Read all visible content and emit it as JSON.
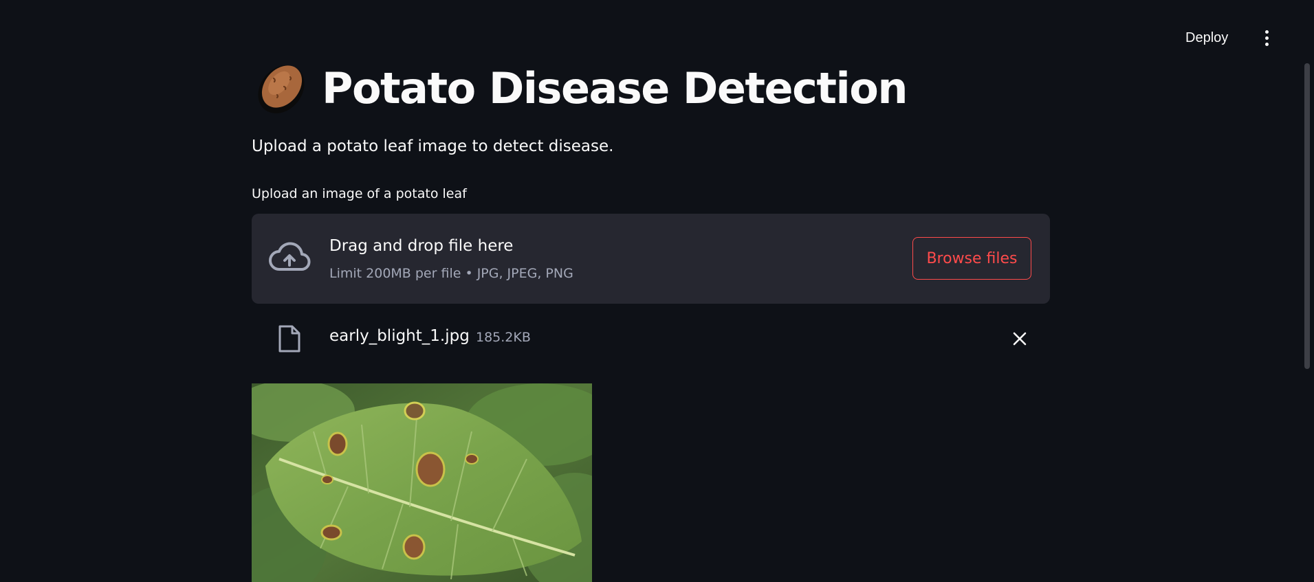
{
  "header": {
    "deploy_label": "Deploy",
    "menu_icon": "vertical-dots-icon"
  },
  "main": {
    "title_icon": "potato-emoji",
    "title": "Potato Disease Detection",
    "subtitle": "Upload a potato leaf image to detect disease."
  },
  "uploader": {
    "label": "Upload an image of a potato leaf",
    "dropzone_icon": "cloud-upload-icon",
    "dropzone_title": "Drag and drop file here",
    "dropzone_subtitle": "Limit 200MB per file • JPG, JPEG, PNG",
    "browse_label": "Browse files"
  },
  "uploaded_file": {
    "icon": "file-icon",
    "name": "early_blight_1.jpg",
    "size": "185.2KB",
    "remove_icon": "close-icon"
  },
  "colors": {
    "background": "#0e1117",
    "dropzone_bg": "#262730",
    "accent": "#ff4b4b",
    "muted_text": "#a3a8b8"
  }
}
